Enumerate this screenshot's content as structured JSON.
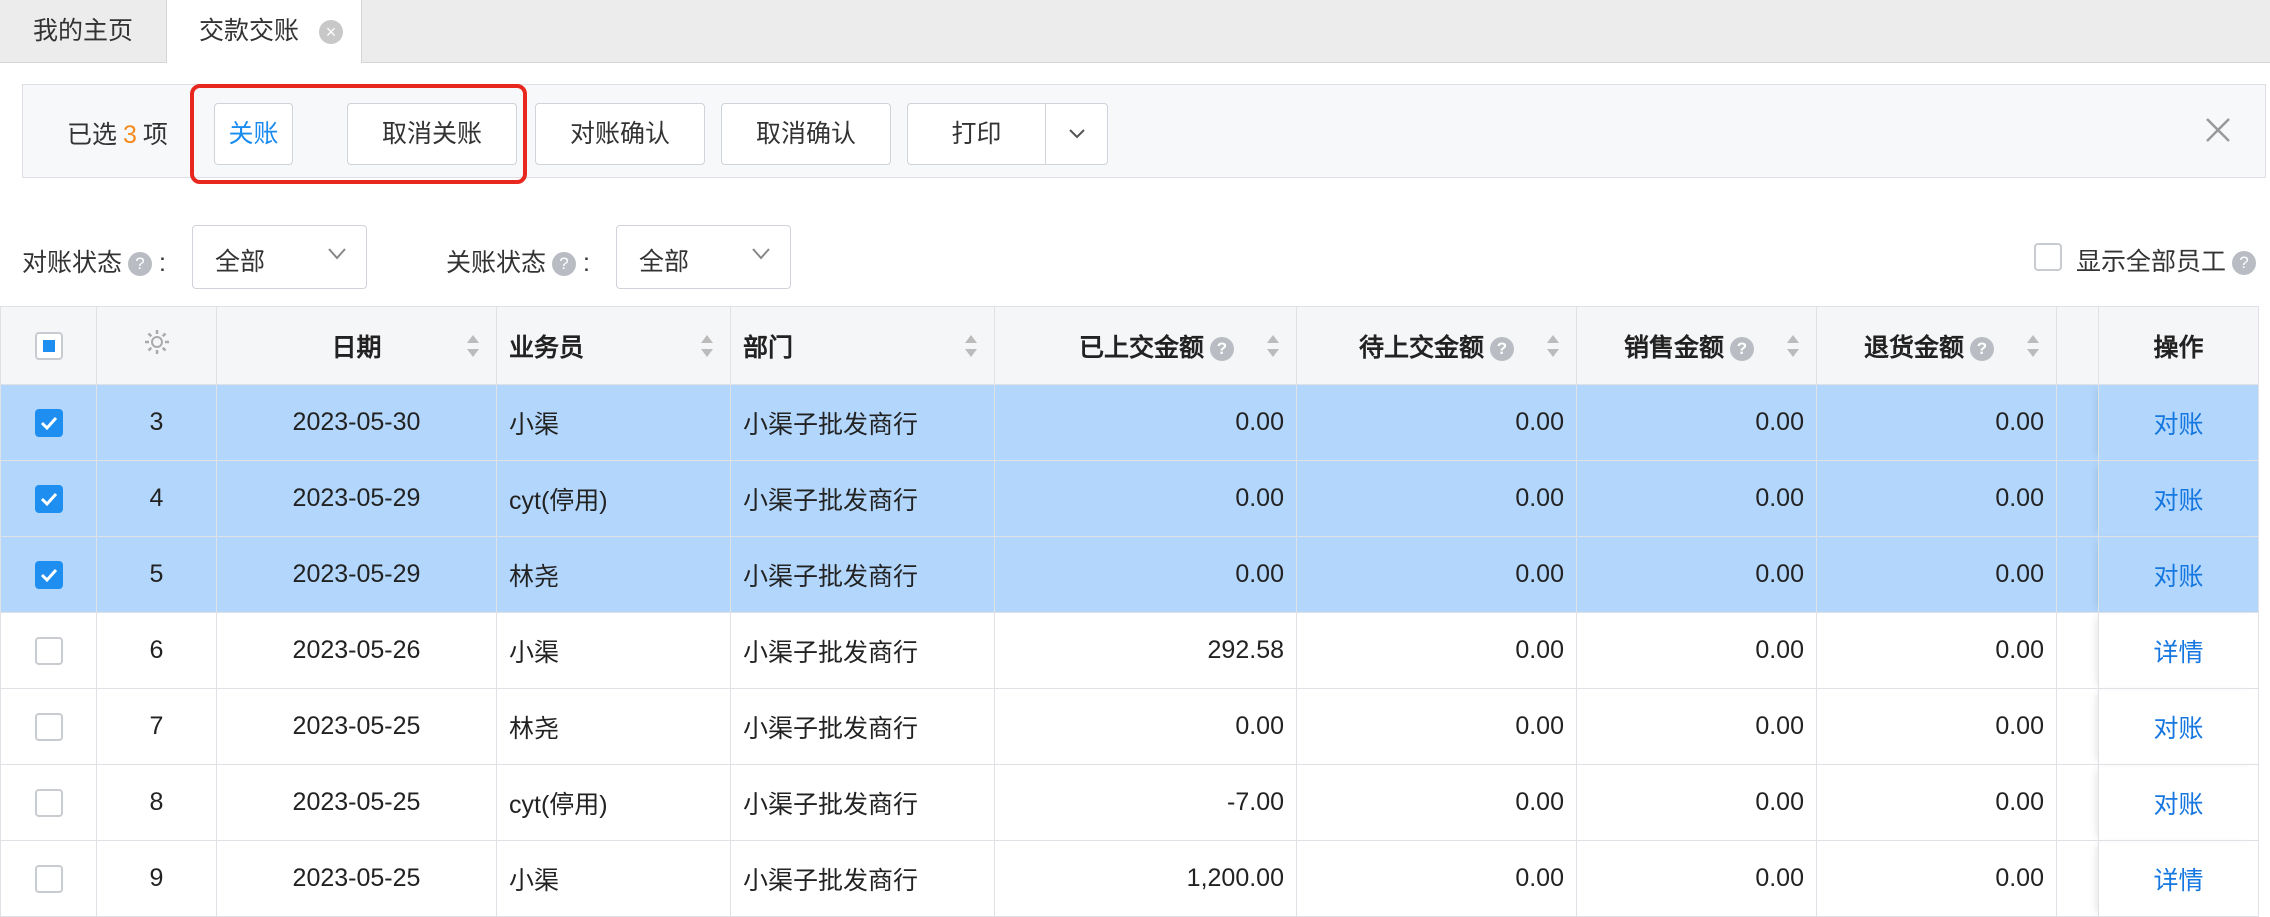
{
  "tabs": [
    {
      "label": "我的主页",
      "active": false
    },
    {
      "label": "交款交账",
      "active": true
    }
  ],
  "toolbar": {
    "selected_prefix": "已选",
    "selected_count": "3",
    "selected_suffix": "项",
    "buttons": {
      "close_account": "关账",
      "cancel_close": "取消关账",
      "confirm_reconcile": "对账确认",
      "cancel_confirm": "取消确认",
      "print": "打印"
    }
  },
  "filters": {
    "reconcile_status_label": "对账状态",
    "reconcile_status_value": "全部",
    "close_status_label": "关账状态",
    "close_status_value": "全部",
    "show_all_employees": "显示全部员工",
    "separator": ":",
    "help_glyph": "?"
  },
  "table": {
    "columns": {
      "date": "日期",
      "salesperson": "业务员",
      "department": "部门",
      "paid_amount": "已上交金额",
      "pending_amount": "待上交金额",
      "sales_amount": "销售金额",
      "return_amount": "退货金额",
      "actions": "操作"
    },
    "rows": [
      {
        "no": "3",
        "date": "2023-05-30",
        "salesperson": "小渠",
        "department": "小渠子批发商行",
        "paid": "0.00",
        "pending": "0.00",
        "sales": "0.00",
        "returns": "0.00",
        "action": "对账",
        "selected": true
      },
      {
        "no": "4",
        "date": "2023-05-29",
        "salesperson": "cyt(停用)",
        "department": "小渠子批发商行",
        "paid": "0.00",
        "pending": "0.00",
        "sales": "0.00",
        "returns": "0.00",
        "action": "对账",
        "selected": true
      },
      {
        "no": "5",
        "date": "2023-05-29",
        "salesperson": "林尧",
        "department": "小渠子批发商行",
        "paid": "0.00",
        "pending": "0.00",
        "sales": "0.00",
        "returns": "0.00",
        "action": "对账",
        "selected": true
      },
      {
        "no": "6",
        "date": "2023-05-26",
        "salesperson": "小渠",
        "department": "小渠子批发商行",
        "paid": "292.58",
        "pending": "0.00",
        "sales": "0.00",
        "returns": "0.00",
        "action": "详情",
        "selected": false
      },
      {
        "no": "7",
        "date": "2023-05-25",
        "salesperson": "林尧",
        "department": "小渠子批发商行",
        "paid": "0.00",
        "pending": "0.00",
        "sales": "0.00",
        "returns": "0.00",
        "action": "对账",
        "selected": false
      },
      {
        "no": "8",
        "date": "2023-05-25",
        "salesperson": "cyt(停用)",
        "department": "小渠子批发商行",
        "paid": "-7.00",
        "pending": "0.00",
        "sales": "0.00",
        "returns": "0.00",
        "action": "对账",
        "selected": false
      },
      {
        "no": "9",
        "date": "2023-05-25",
        "salesperson": "小渠",
        "department": "小渠子批发商行",
        "paid": "1,200.00",
        "pending": "0.00",
        "sales": "0.00",
        "returns": "0.00",
        "action": "详情",
        "selected": false
      }
    ]
  },
  "icons": {
    "settings": "gear-icon",
    "sort": "sort-icon",
    "help": "help-icon",
    "close": "close-icon",
    "dropdown": "chevron-down-icon",
    "checkbox": "checkbox-icon"
  },
  "colors": {
    "accent": "#1a8cf0",
    "selected_row": "#b3d7fc",
    "count_highlight": "#f58a1f",
    "annotation_box": "#e8271e"
  }
}
